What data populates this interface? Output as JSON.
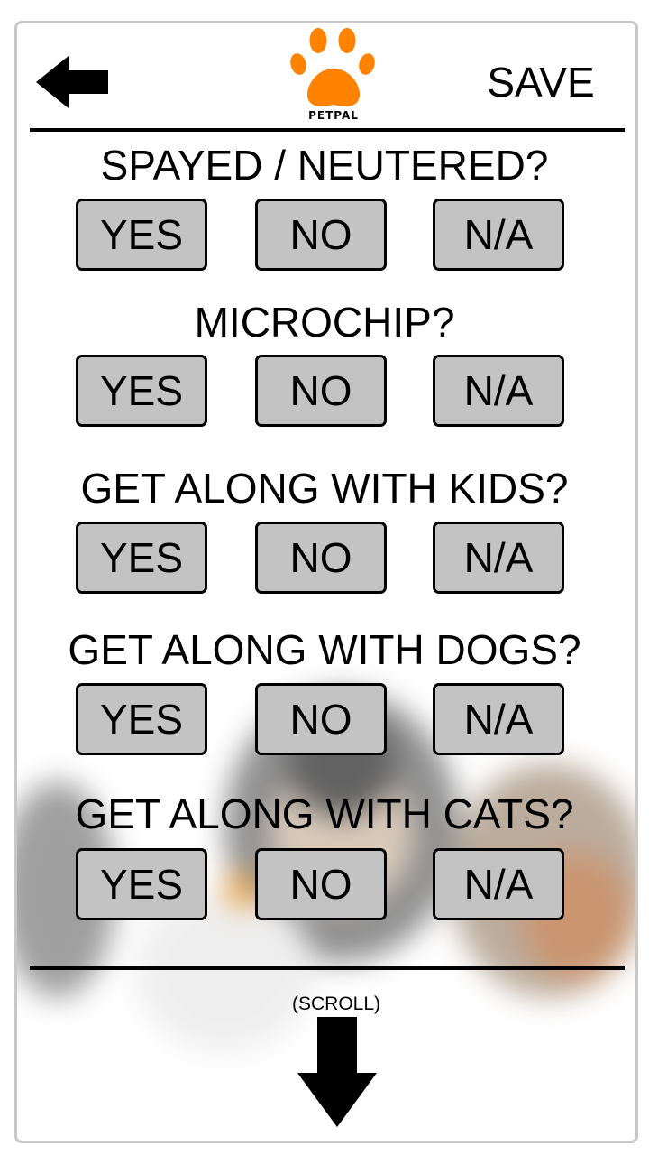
{
  "app": {
    "logo_text": "PETPAL"
  },
  "header": {
    "save_label": "SAVE"
  },
  "questions": [
    {
      "label": "SPAYED / NEUTERED?",
      "options": [
        "YES",
        "NO",
        "N/A"
      ]
    },
    {
      "label": "MICROCHIP?",
      "options": [
        "YES",
        "NO",
        "N/A"
      ]
    },
    {
      "label": "GET ALONG WITH KIDS?",
      "options": [
        "YES",
        "NO",
        "N/A"
      ]
    },
    {
      "label": "GET ALONG WITH DOGS?",
      "options": [
        "YES",
        "NO",
        "N/A"
      ]
    },
    {
      "label": "GET ALONG WITH CATS?",
      "options": [
        "YES",
        "NO",
        "N/A"
      ]
    }
  ],
  "footer": {
    "scroll_label": "(SCROLL)"
  },
  "colors": {
    "accent": "#ff8200",
    "button_fill": "#c3c3c3",
    "text": "#000000"
  },
  "icons": [
    "back-arrow-icon",
    "paw-logo-icon",
    "scroll-down-arrow-icon"
  ]
}
